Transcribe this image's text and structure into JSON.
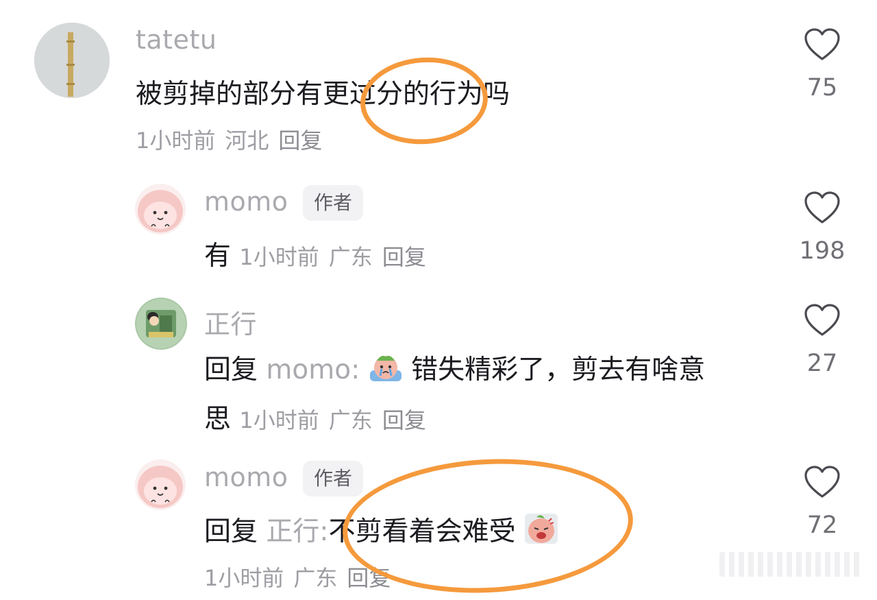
{
  "comments": [
    {
      "user": "tatetu",
      "text": "被剪掉的部分有更过分的行为吗",
      "time": "1小时前",
      "location": "河北",
      "reply_label": "回复",
      "likes": "75"
    },
    {
      "user": "momo",
      "badge": "作者",
      "text": "有",
      "time": "1小时前",
      "location": "广东",
      "reply_label": "回复",
      "likes": "198"
    },
    {
      "user": "正行",
      "reply_prefix": "回复",
      "reply_to": "momo:",
      "text_line1": "错失精彩了，剪去有啥意",
      "text_line2": "思",
      "time": "1小时前",
      "location": "广东",
      "reply_label": "回复",
      "likes": "27"
    },
    {
      "user": "momo",
      "badge": "作者",
      "reply_prefix": "回复",
      "reply_to": "正行:",
      "text": "不剪看着会难受",
      "time": "1小时前",
      "location": "广东",
      "reply_label": "回复",
      "likes": "72"
    }
  ],
  "icons": {
    "like": "heart-outline-icon",
    "emoji_crying": "crying-emoji-icon",
    "emoji_annoyed": "annoyed-emoji-icon"
  },
  "colors": {
    "highlight_ring": "#f59a3d",
    "muted_text": "#a9a9ae"
  }
}
